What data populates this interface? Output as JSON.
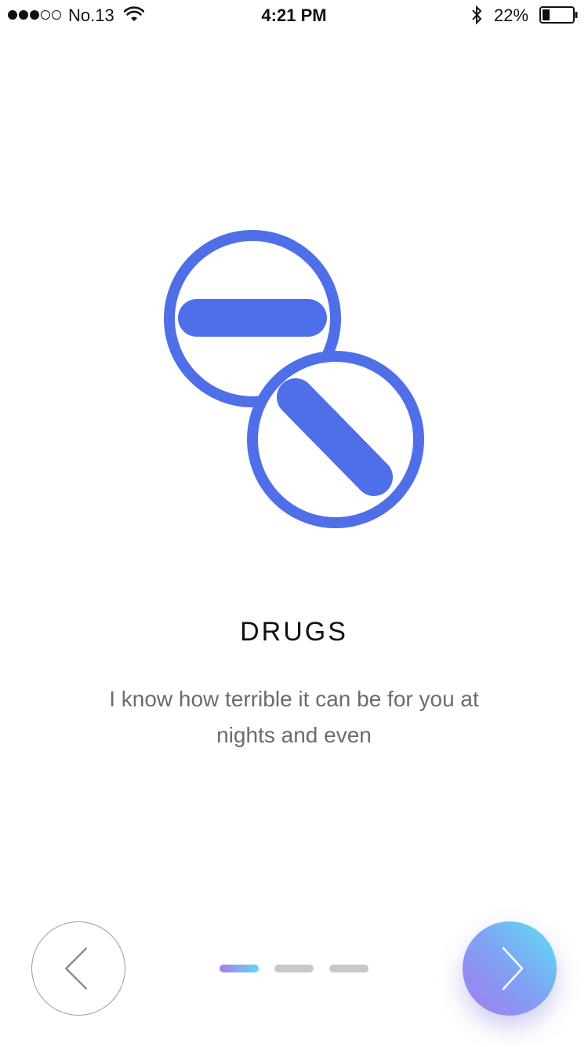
{
  "status_bar": {
    "carrier": "No.13",
    "time": "4:21 PM",
    "battery": "22%",
    "signal_bars_filled": 3,
    "signal_bars_total": 5
  },
  "onboarding": {
    "illustration_icon": "pills-icon",
    "title": "DRUGS",
    "description": "I know how terrible it can be for you at nights and even",
    "accent_color": "#4f6fe8"
  },
  "navigation": {
    "prev_icon": "chevron-left-icon",
    "next_icon": "chevron-right-icon",
    "page_count": 3,
    "active_page": 1
  }
}
